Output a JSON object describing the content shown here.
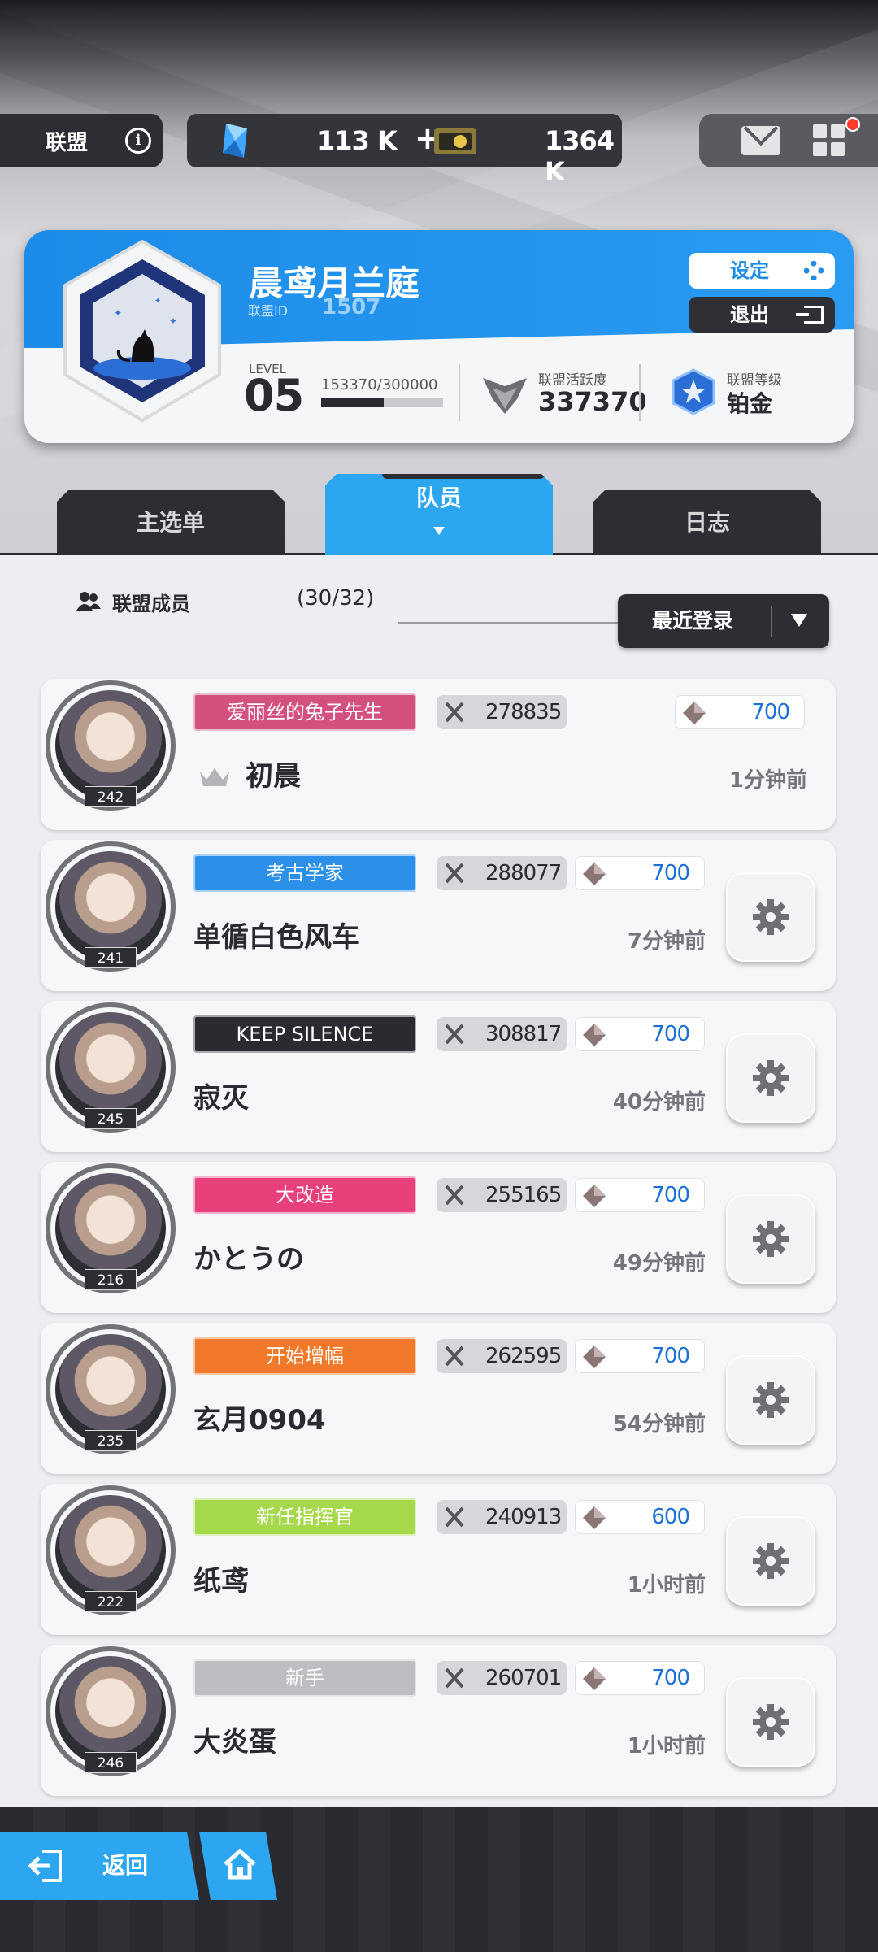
{
  "topbar": {
    "alliance_label": "联盟",
    "gems": "113 K",
    "gems_plus": "+",
    "coins": "1364 K"
  },
  "guild": {
    "name": "晨鸢月兰庭",
    "id_label": "联盟ID",
    "id": "1507",
    "settings_label": "设定",
    "exit_label": "退出",
    "level_label": "LEVEL",
    "level": "05",
    "exp": "153370/300000",
    "exp_fraction": 0.51,
    "activity_label": "联盟活跃度",
    "activity": "337370",
    "rank_label": "联盟等级",
    "rank": "铂金"
  },
  "tabs": [
    {
      "label": "主选单",
      "active": false
    },
    {
      "label": "队员",
      "active": true
    },
    {
      "label": "日志",
      "active": false
    }
  ],
  "members_header": {
    "label": "联盟成员",
    "count": "(30/32)",
    "sort_label": "最近登录"
  },
  "members": [
    {
      "title": "爱丽丝的兔子先生",
      "title_color": "#d4507e",
      "power": "278835",
      "contrib": "700",
      "name": "初晨",
      "time": "1分钟前",
      "level": "242",
      "leader": true
    },
    {
      "title": "考古学家",
      "title_color": "#2c8fe8",
      "power": "288077",
      "contrib": "700",
      "name": "单循白色风车",
      "time": "7分钟前",
      "level": "241",
      "leader": false
    },
    {
      "title": "KEEP SILENCE",
      "title_color": "#2a2b30",
      "power": "308817",
      "contrib": "700",
      "name": "寂灭",
      "time": "40分钟前",
      "level": "245",
      "leader": false
    },
    {
      "title": "大改造",
      "title_color": "#e8407a",
      "power": "255165",
      "contrib": "700",
      "name": "かとうの",
      "time": "49分钟前",
      "level": "216",
      "leader": false
    },
    {
      "title": "开始增幅",
      "title_color": "#f2792a",
      "power": "262595",
      "contrib": "700",
      "name": "玄月0904",
      "time": "54分钟前",
      "level": "235",
      "leader": false
    },
    {
      "title": "新任指挥官",
      "title_color": "#a5d84a",
      "power": "240913",
      "contrib": "600",
      "name": "纸鸢",
      "time": "1小时前",
      "level": "222",
      "leader": false
    },
    {
      "title": "新手",
      "title_color": "#bdbec2",
      "power": "260701",
      "contrib": "700",
      "name": "大炎蛋",
      "time": "1小时前",
      "level": "246",
      "leader": false
    }
  ],
  "bottom": {
    "back_label": "返回"
  },
  "colors": {
    "accent": "#2ca6f0",
    "dark": "#2d2e33",
    "contrib_text": "#1b6fd8"
  }
}
